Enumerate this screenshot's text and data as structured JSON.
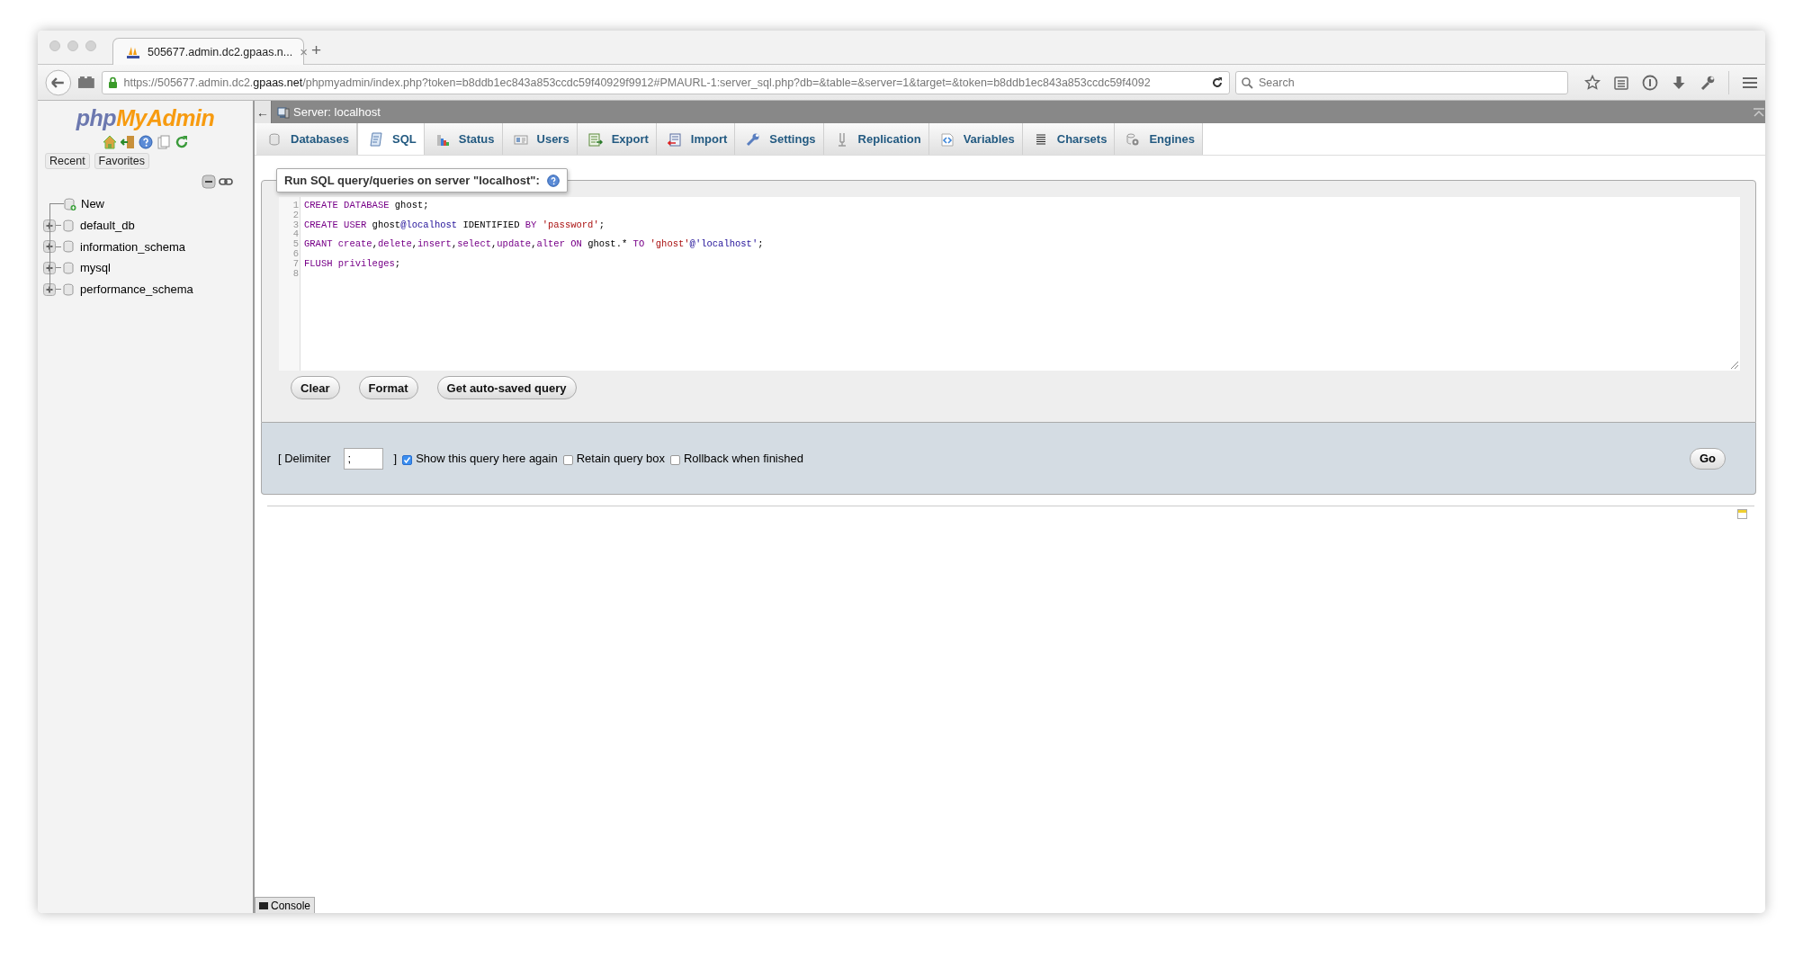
{
  "browser": {
    "tab": {
      "title": "505677.admin.dc2.gpaas.n...",
      "close": "×"
    },
    "new_tab": "+",
    "url": {
      "scheme": "https://505677.admin.dc2.",
      "domain": "gpaas.net",
      "rest": "/phpmyadmin/index.php?token=b8ddb1ec843a853ccdc59f40929f9912#PMAURL-1:server_sql.php?db=&table=&server=1&target=&token=b8ddb1ec843a853ccdc59f4092"
    },
    "search": {
      "placeholder": "Search"
    }
  },
  "sidebar": {
    "logo": {
      "part_1": "php",
      "part_2": "MyAdmin"
    },
    "buttons": [
      "Recent",
      "Favorites"
    ],
    "tree": [
      {
        "kind": "new",
        "label": "New"
      },
      {
        "kind": "database",
        "label": "default_db",
        "expanded": false
      },
      {
        "kind": "database",
        "label": "information_schema",
        "expanded": false
      },
      {
        "kind": "database",
        "label": "mysql",
        "expanded": false
      },
      {
        "kind": "database",
        "label": "performance_schema",
        "expanded": false
      }
    ]
  },
  "server_bar": {
    "back": "←",
    "title": "Server: localhost"
  },
  "tabs": [
    {
      "label": "Databases",
      "selected": false
    },
    {
      "label": "SQL",
      "selected": true
    },
    {
      "label": "Status",
      "selected": false
    },
    {
      "label": "Users",
      "selected": false
    },
    {
      "label": "Export",
      "selected": false
    },
    {
      "label": "Import",
      "selected": false
    },
    {
      "label": "Settings",
      "selected": false
    },
    {
      "label": "Replication",
      "selected": false
    },
    {
      "label": "Variables",
      "selected": false
    },
    {
      "label": "Charsets",
      "selected": false
    },
    {
      "label": "Engines",
      "selected": false
    }
  ],
  "query_panel": {
    "legend": "Run SQL query/queries on server \"localhost\":",
    "editor": {
      "lines": [
        {
          "number": "1",
          "tokens": [
            {
              "kind": "keyword",
              "text": "CREATE DATABASE"
            },
            {
              "kind": "plain",
              "text": " ghost;"
            }
          ]
        },
        {
          "number": "2"
        },
        {
          "number": "3",
          "tokens": [
            {
              "kind": "keyword",
              "text": "CREATE USER"
            },
            {
              "kind": "plain",
              "text": " ghost"
            },
            {
              "kind": "atom",
              "text": "@localhost"
            },
            {
              "kind": "plain",
              "text": " IDENTIFIED "
            },
            {
              "kind": "keyword",
              "text": "BY"
            },
            {
              "kind": "string",
              "text": " 'password'"
            },
            {
              "kind": "plain",
              "text": ";"
            }
          ]
        },
        {
          "number": "4"
        },
        {
          "number": "5",
          "tokens": [
            {
              "kind": "keyword",
              "text": "GRANT create"
            },
            {
              "kind": "plain",
              "text": ","
            },
            {
              "kind": "keyword",
              "text": "delete"
            },
            {
              "kind": "plain",
              "text": ","
            },
            {
              "kind": "keyword",
              "text": "insert"
            },
            {
              "kind": "plain",
              "text": ","
            },
            {
              "kind": "keyword",
              "text": "select"
            },
            {
              "kind": "plain",
              "text": ","
            },
            {
              "kind": "keyword",
              "text": "update"
            },
            {
              "kind": "plain",
              "text": ","
            },
            {
              "kind": "keyword",
              "text": "alter ON"
            },
            {
              "kind": "plain",
              "text": " ghost.* "
            },
            {
              "kind": "keyword",
              "text": "TO"
            },
            {
              "kind": "string",
              "text": " 'ghost'"
            },
            {
              "kind": "atom",
              "text": "@'localhost'"
            },
            {
              "kind": "plain",
              "text": ";"
            }
          ]
        },
        {
          "number": "6"
        },
        {
          "number": "7",
          "tokens": [
            {
              "kind": "keyword",
              "text": "FLUSH privileges"
            },
            {
              "kind": "plain",
              "text": ";"
            }
          ]
        },
        {
          "number": "8"
        }
      ]
    },
    "buttons": [
      "Clear",
      "Format",
      "Get auto-saved query"
    ]
  },
  "options": {
    "delimiter_open": "[ Delimiter",
    "delimiter": ";",
    "delimiter_close": "]",
    "checkboxes": [
      {
        "label": "Show this query here again",
        "checked": true
      },
      {
        "label": "Retain query box",
        "checked": false
      },
      {
        "label": "Rollback when finished",
        "checked": false
      }
    ],
    "go": "Go"
  },
  "console": "Console"
}
